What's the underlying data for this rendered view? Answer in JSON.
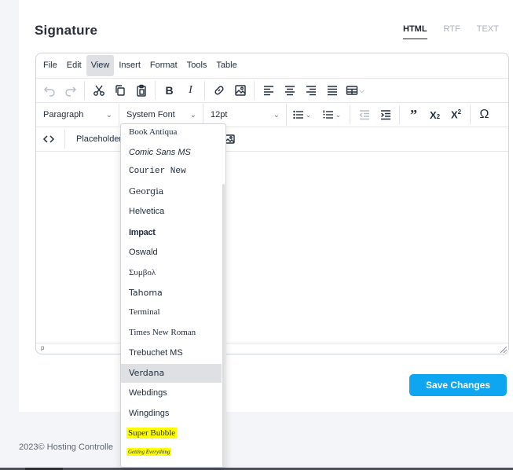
{
  "page": {
    "title": "Signature",
    "format_tabs": [
      {
        "label": "HTML",
        "active": true
      },
      {
        "label": "RTF",
        "active": false
      },
      {
        "label": "TEXT",
        "active": false
      }
    ],
    "save_button": "Save Changes",
    "footer": "2023© Hosting Controlle"
  },
  "editor": {
    "menu": [
      "File",
      "Edit",
      "View",
      "Insert",
      "Format",
      "Tools",
      "Table"
    ],
    "active_menu": "View",
    "block_format": "Paragraph",
    "font_family": "System Font",
    "font_size": "12pt",
    "placeholder_button": "Placeholder",
    "status_path": "p"
  },
  "font_dropdown": {
    "items": [
      "Book Antiqua",
      "Comic Sans MS",
      "Courier New",
      "Georgia",
      "Helvetica",
      "Impact",
      "Oswald",
      "Συμβολ",
      "Tahoma",
      "Terminal",
      "Times New Roman",
      "Trebuchet MS",
      "Verdana",
      "Webdings",
      "Wingdings",
      "Super Bubble",
      "Getting Everything"
    ],
    "hovered": "Verdana",
    "highlighted": [
      "Super Bubble",
      "Getting Everything"
    ]
  },
  "colors": {
    "accent": "#0ea5f1",
    "highlight": "#ffff00"
  }
}
